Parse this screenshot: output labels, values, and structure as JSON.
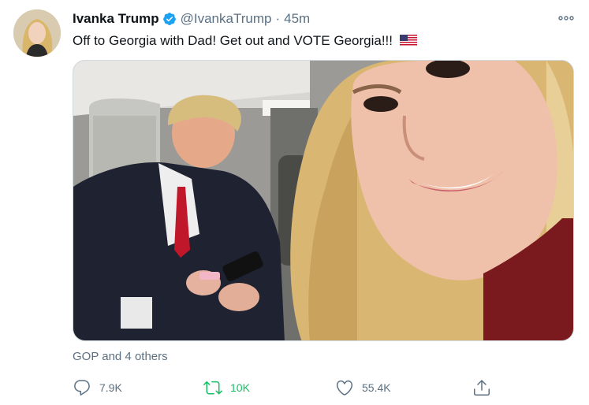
{
  "author": {
    "name": "Ivanka Trump",
    "handle": "@IvankaTrump",
    "separator": "·",
    "time": "45m"
  },
  "tweet": {
    "text": "Off to Georgia with Dad! Get out and VOTE Georgia!!!",
    "emoji_icon": "us-flag-icon"
  },
  "social_context": "GOP and 4 others",
  "actions": {
    "reply_count": "7.9K",
    "retweet_count": "10K",
    "like_count": "55.4K"
  },
  "colors": {
    "text_primary": "#0f1419",
    "text_secondary": "#5b7083",
    "verified_blue": "#1da1f2",
    "retweet_green": "#17bf63"
  }
}
